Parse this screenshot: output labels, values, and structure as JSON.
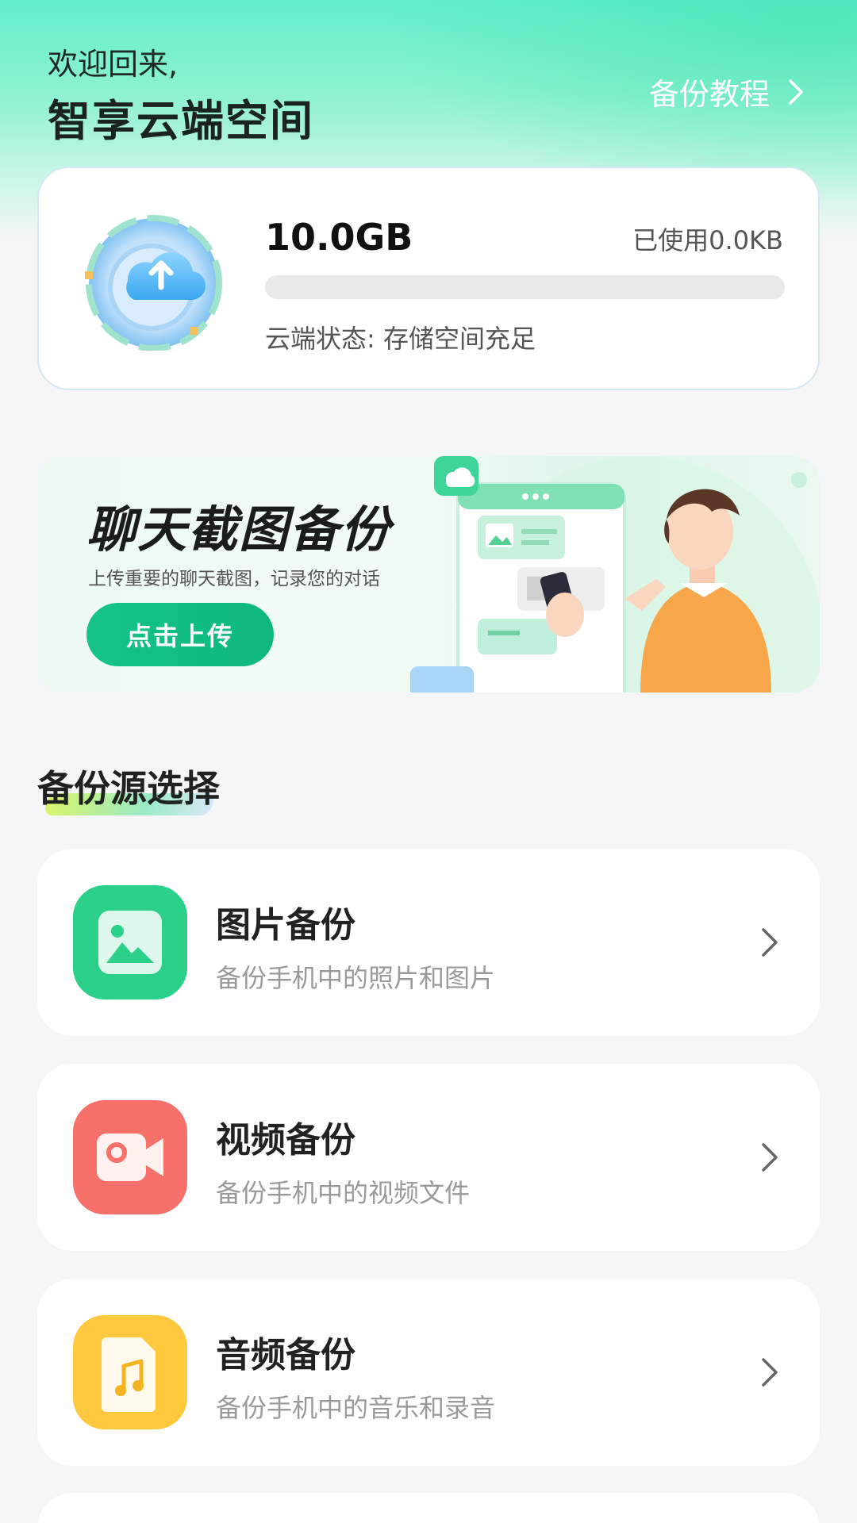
{
  "header": {
    "welcome": "欢迎回来,",
    "title": "智享云端空间",
    "tutorial_link": "备份教程"
  },
  "storage": {
    "capacity": "10.0GB",
    "used": "已使用0.0KB",
    "used_fraction": 0,
    "status": "云端状态: 存储空间充足"
  },
  "banner": {
    "title": "聊天截图备份",
    "subtitle": "上传重要的聊天截图，记录您的对话",
    "button": "点击上传"
  },
  "section": {
    "title": "备份源选择"
  },
  "sources": [
    {
      "name": "图片备份",
      "desc": "备份手机中的照片和图片",
      "icon": "image-icon",
      "color": "#2bd188"
    },
    {
      "name": "视频备份",
      "desc": "备份手机中的视频文件",
      "icon": "video-camera-icon",
      "color": "#f7706a"
    },
    {
      "name": "音频备份",
      "desc": "备份手机中的音乐和录音",
      "icon": "music-note-icon",
      "color": "#ffc83d"
    }
  ],
  "colors": {
    "accent_green": "#14c48a",
    "background": "#f4f6f8"
  }
}
